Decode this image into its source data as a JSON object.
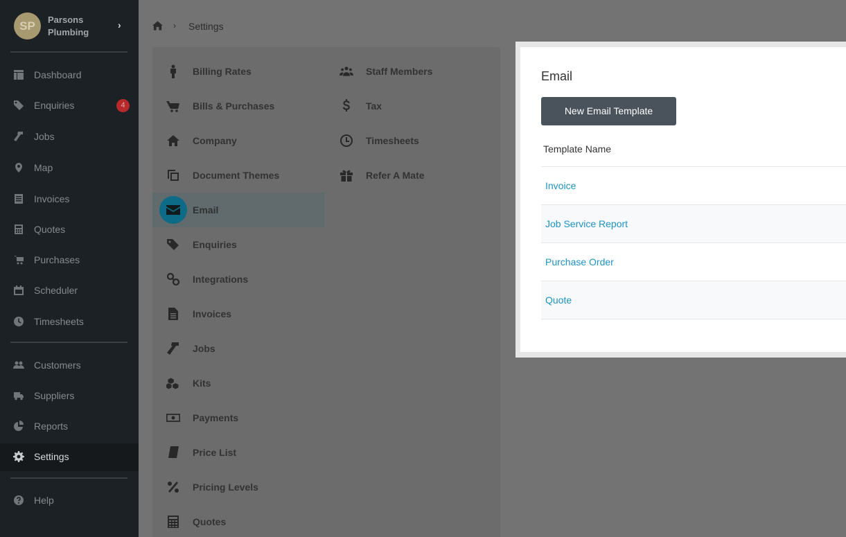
{
  "brand": {
    "initials": "SP",
    "name": "Parsons Plumbing",
    "chevron": "›"
  },
  "sidebar": {
    "items": [
      {
        "label": "Dashboard",
        "icon": "dashboard-icon"
      },
      {
        "label": "Enquiries",
        "icon": "tags-icon",
        "badge": "4"
      },
      {
        "label": "Jobs",
        "icon": "hammer-icon"
      },
      {
        "label": "Map",
        "icon": "map-marker-icon"
      },
      {
        "label": "Invoices",
        "icon": "invoice-icon"
      },
      {
        "label": "Quotes",
        "icon": "calculator-icon"
      },
      {
        "label": "Purchases",
        "icon": "cart-icon"
      },
      {
        "label": "Scheduler",
        "icon": "calendar-icon"
      },
      {
        "label": "Timesheets",
        "icon": "clock-icon"
      },
      {
        "label": "Customers",
        "icon": "users-icon"
      },
      {
        "label": "Suppliers",
        "icon": "truck-icon"
      },
      {
        "label": "Reports",
        "icon": "pie-chart-icon"
      },
      {
        "label": "Settings",
        "icon": "gear-icon",
        "active": true
      },
      {
        "label": "Help",
        "icon": "help-icon"
      }
    ]
  },
  "breadcrumb": {
    "separator": "›",
    "current": "Settings"
  },
  "settings": {
    "left": [
      {
        "label": "Billing Rates",
        "icon": "person-icon"
      },
      {
        "label": "Bills & Purchases",
        "icon": "cart-icon"
      },
      {
        "label": "Company",
        "icon": "home-icon"
      },
      {
        "label": "Document Themes",
        "icon": "copy-icon"
      },
      {
        "label": "Email",
        "icon": "envelope-icon",
        "active": true
      },
      {
        "label": "Enquiries",
        "icon": "tags-icon"
      },
      {
        "label": "Integrations",
        "icon": "link-icon"
      },
      {
        "label": "Invoices",
        "icon": "file-icon"
      },
      {
        "label": "Jobs",
        "icon": "hammer-icon"
      },
      {
        "label": "Kits",
        "icon": "cubes-icon"
      },
      {
        "label": "Payments",
        "icon": "money-icon"
      },
      {
        "label": "Price List",
        "icon": "book-icon"
      },
      {
        "label": "Pricing Levels",
        "icon": "percent-icon"
      },
      {
        "label": "Quotes",
        "icon": "calculator-icon"
      }
    ],
    "right": [
      {
        "label": "Staff Members",
        "icon": "users-icon"
      },
      {
        "label": "Tax",
        "icon": "dollar-icon"
      },
      {
        "label": "Timesheets",
        "icon": "clock-icon"
      },
      {
        "label": "Refer A Mate",
        "icon": "gift-icon"
      }
    ]
  },
  "email_panel": {
    "title": "Email",
    "new_button": "New Email Template",
    "column_header": "Template Name",
    "rows": [
      "Invoice",
      "Job Service Report",
      "Purchase Order",
      "Quote"
    ]
  },
  "colors": {
    "sidebar_bg": "#1c2126",
    "accent": "#0e6b87",
    "link": "#1e94c4",
    "button_bg": "#4a525b",
    "badge": "#b8292b"
  }
}
